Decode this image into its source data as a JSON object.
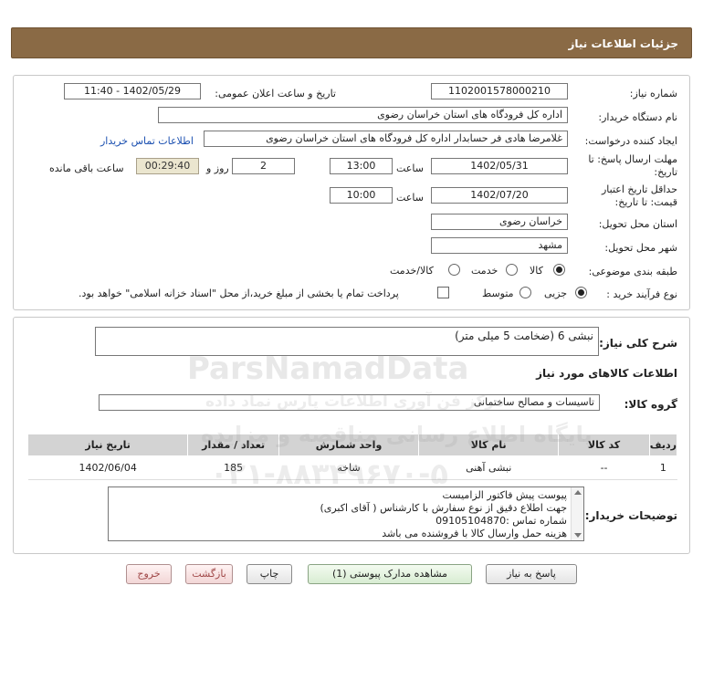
{
  "header": {
    "title": "جزئیات اطلاعات نیاز"
  },
  "form": {
    "need_number_label": "شماره نیاز:",
    "need_number": "1102001578000210",
    "announce_label": "تاریخ و ساعت اعلان عمومی:",
    "announce_value": "1402/05/29 - 11:40",
    "buyer_label": "نام دستگاه خریدار:",
    "buyer_value": "اداره کل فرودگاه های استان خراسان رضوی",
    "creator_label": "ایجاد کننده درخواست:",
    "creator_value": "غلامرضا هادی فر حسابدار اداره کل فرودگاه های استان خراسان رضوی",
    "contact_link": "اطلاعات تماس خریدار",
    "deadline_label_1": "مهلت ارسال پاسخ: تا",
    "deadline_label_2": "تاریخ:",
    "deadline_date": "1402/05/31",
    "time_label": "ساعت",
    "deadline_time": "13:00",
    "days_value": "2",
    "days_label": "روز و",
    "remaining_time": "00:29:40",
    "remaining_label": "ساعت باقی مانده",
    "validity_label_1": "حداقل تاریخ اعتبار",
    "validity_label_2": "قیمت: تا تاریخ:",
    "validity_date": "1402/07/20",
    "validity_time_label": "ساعت",
    "validity_time": "10:00",
    "province_label": "استان محل تحویل:",
    "province_value": "خراسان رضوی",
    "city_label": "شهر محل تحویل:",
    "city_value": "مشهد",
    "category_label": "طبقه بندی موضوعی:",
    "category_options": [
      "کالا",
      "خدمت",
      "کالا/خدمت"
    ],
    "category_selected": "کالا",
    "process_label": "نوع فرآیند خرید :",
    "process_options": [
      "جزیی",
      "متوسط"
    ],
    "process_selected": "جزیی",
    "payment_note": "پرداخت تمام یا بخشی از مبلغ خرید،از محل \"اسناد خزانه اسلامی\" خواهد بود."
  },
  "description": {
    "label": "شرح کلی نیاز:",
    "value": "نبشی 6 (ضخامت 5 میلی متر)"
  },
  "goods": {
    "section_title": "اطلاعات کالاهای مورد نیاز",
    "group_label": "گروه کالا:",
    "group_value": "تاسیسات و مصالح ساختمانی",
    "columns": [
      "ردیف",
      "کد کالا",
      "نام کالا",
      "واحد شمارش",
      "تعداد / مقدار",
      "تاریخ نیاز"
    ],
    "rows": [
      [
        "1",
        "--",
        "نبشی آهنی",
        "شاخه",
        "185",
        "1402/06/04"
      ]
    ]
  },
  "buyer_notes": {
    "label": "توضیحات خریدار:",
    "lines": [
      "پیوست پیش فاکتور الزامیست",
      "جهت اطلاع دقیق از نوع سفارش با کارشناس   ( آقای اکبری)",
      "شماره تماس :09105104870",
      "هزینه حمل وارسال کالا با فروشنده می باشد"
    ]
  },
  "buttons": {
    "reply": "پاسخ به نیاز",
    "attachments": "مشاهده مدارک پیوستی (1)",
    "print": "چاپ",
    "back": "بازگشت",
    "exit": "خروج"
  },
  "watermark": {
    "brand": "ParsNamadData",
    "line1": "پایگاه اطلاع رسانی مناقصه و مزایده",
    "phone": "۰۲۱-۸۸۳۴۹۶۷۰-۵",
    "line2": "مرکز فن آوری اطلاعات پارس نماد داده"
  },
  "colors": {
    "header_bg": "#8a6a45",
    "table_header_bg": "#d3d3d3",
    "timer_bg": "#ebe6cf",
    "link": "#1a4fb0"
  }
}
